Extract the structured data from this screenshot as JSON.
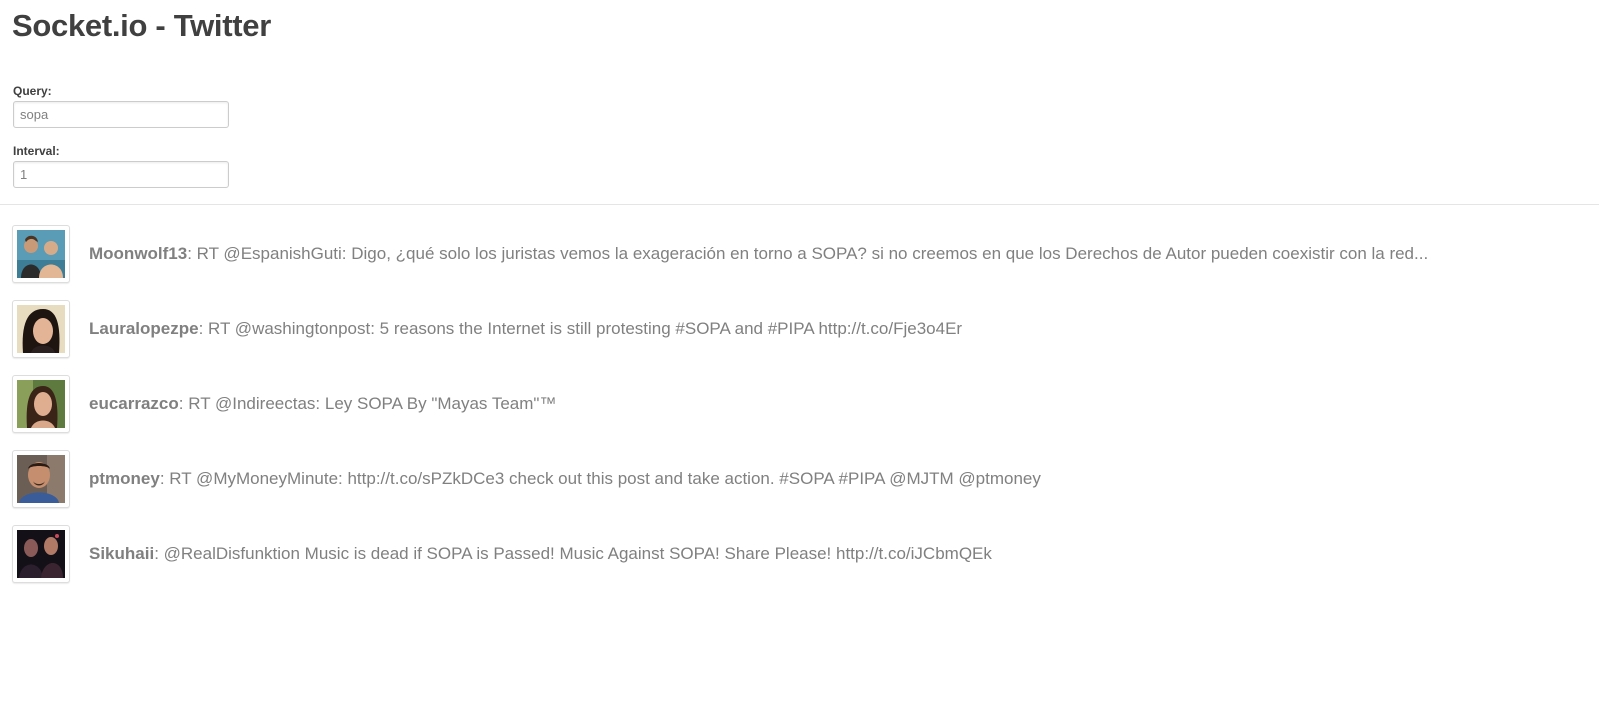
{
  "header": {
    "title": "Socket.io - Twitter"
  },
  "form": {
    "query": {
      "label": "Query:",
      "value": "sopa"
    },
    "interval": {
      "label": "Interval:",
      "value": "1"
    }
  },
  "tweets": [
    {
      "user": "Moonwolf13",
      "text": ": RT @EspanishGuti: Digo, ¿qué solo los juristas vemos la exageración en torno a SOPA? si no creemos en que los Derechos de Autor pueden coexistir con la red..."
    },
    {
      "user": "Lauralopezpe",
      "text": ": RT @washingtonpost: 5 reasons the Internet is still protesting #SOPA and #PIPA http://t.co/Fje3o4Er"
    },
    {
      "user": "eucarrazco",
      "text": ": RT @Indireectas: Ley SOPA By \"Mayas Team\"™"
    },
    {
      "user": "ptmoney",
      "text": ": RT @MyMoneyMinute: http://t.co/sPZkDCe3 check out this post and take action. #SOPA #PIPA @MJTM @ptmoney"
    },
    {
      "user": "Sikuhaii",
      "text": ": @RealDisfunktion Music is dead if SOPA is Passed! Music Against SOPA! Share Please! http://t.co/iJCbmQEk"
    }
  ]
}
